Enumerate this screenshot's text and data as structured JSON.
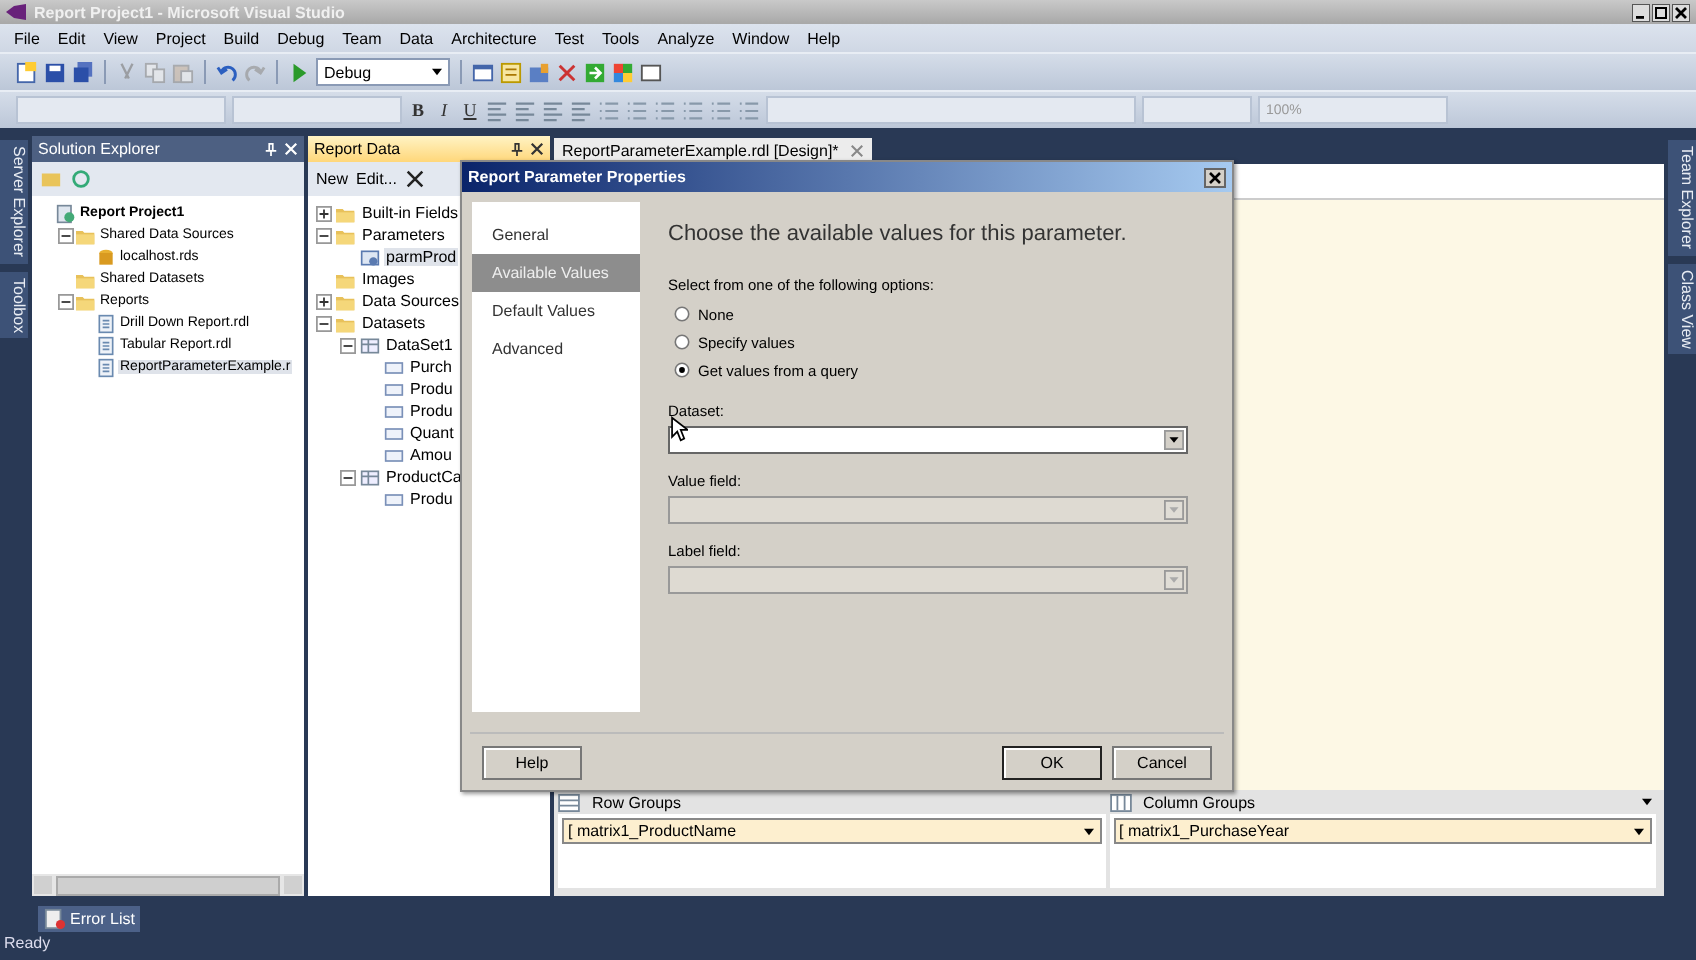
{
  "window": {
    "title": "Report Project1 - Microsoft Visual Studio"
  },
  "menu": [
    "File",
    "Edit",
    "View",
    "Project",
    "Build",
    "Debug",
    "Team",
    "Data",
    "Architecture",
    "Test",
    "Tools",
    "Analyze",
    "Window",
    "Help"
  ],
  "toolbar": {
    "configuration": "Debug",
    "format_buttons": [
      "B",
      "I",
      "U"
    ],
    "zoom": "100%"
  },
  "left_strip": [
    "Server Explorer",
    "Toolbox"
  ],
  "solution_explorer": {
    "title": "Solution Explorer",
    "tree": [
      {
        "label": "Report Project1",
        "kind": "project",
        "selected": false,
        "children": [
          {
            "label": "Shared Data Sources",
            "kind": "folder",
            "expanded": true,
            "selected": false,
            "children": [
              {
                "label": "localhost.rds",
                "kind": "datasource",
                "selected": false
              }
            ]
          },
          {
            "label": "Shared Datasets",
            "kind": "folder",
            "selected": false
          },
          {
            "label": "Reports",
            "kind": "folder",
            "expanded": true,
            "selected": false,
            "children": [
              {
                "label": "Drill Down Report.rdl",
                "kind": "report",
                "selected": false
              },
              {
                "label": "Tabular Report.rdl",
                "kind": "report",
                "selected": false
              },
              {
                "label": "ReportParameterExample.r",
                "kind": "report",
                "selected": true
              }
            ]
          }
        ]
      }
    ]
  },
  "report_data": {
    "title": "Report Data",
    "new": "New",
    "edit": "Edit...",
    "tree": [
      {
        "label": "Built-in Fields",
        "kind": "folder",
        "expanded": false,
        "selected": false
      },
      {
        "label": "Parameters",
        "kind": "folder",
        "expanded": true,
        "selected": false,
        "children": [
          {
            "label": "parmProd",
            "kind": "parameter",
            "selected": true
          }
        ]
      },
      {
        "label": "Images",
        "kind": "folder",
        "selected": false
      },
      {
        "label": "Data Sources",
        "kind": "folder",
        "expanded": false,
        "selected": false
      },
      {
        "label": "Datasets",
        "kind": "folder",
        "expanded": true,
        "selected": false,
        "children": [
          {
            "label": "DataSet1",
            "kind": "dataset",
            "expanded": true,
            "selected": false,
            "children": [
              {
                "label": "Purch",
                "kind": "field",
                "selected": false
              },
              {
                "label": "Produ",
                "kind": "field",
                "selected": false
              },
              {
                "label": "Produ",
                "kind": "field",
                "selected": false
              },
              {
                "label": "Quant",
                "kind": "field",
                "selected": false
              },
              {
                "label": "Amou",
                "kind": "field",
                "selected": false
              }
            ]
          },
          {
            "label": "ProductCa",
            "kind": "dataset",
            "expanded": true,
            "selected": false,
            "children": [
              {
                "label": "Produ",
                "kind": "field",
                "selected": false
              }
            ]
          }
        ]
      }
    ]
  },
  "document_tab": {
    "title": "ReportParameterExample.rdl [Design]*"
  },
  "groups": {
    "row": {
      "title": "Row Groups",
      "item": "[ matrix1_ProductName"
    },
    "column": {
      "title": "Column Groups",
      "item": "[ matrix1_PurchaseYear"
    }
  },
  "dialog": {
    "title": "Report Parameter Properties",
    "nav": [
      {
        "label": "General",
        "selected": false
      },
      {
        "label": "Available Values",
        "selected": true
      },
      {
        "label": "Default Values",
        "selected": false
      },
      {
        "label": "Advanced",
        "selected": false
      }
    ],
    "heading": "Choose the available values for this parameter.",
    "prompt": "Select from one of the following options:",
    "options": [
      {
        "label": "None",
        "selected": false
      },
      {
        "label": "Specify values",
        "selected": false
      },
      {
        "label": "Get values from a query",
        "selected": true
      }
    ],
    "fields": [
      {
        "label": "Dataset:",
        "disabled": false
      },
      {
        "label": "Value field:",
        "disabled": true
      },
      {
        "label": "Label field:",
        "disabled": true
      }
    ],
    "buttons": {
      "help": "Help",
      "ok": "OK",
      "cancel": "Cancel"
    }
  },
  "right_strip": [
    "Team Explorer",
    "Class View"
  ],
  "bottom_tab": "Error List",
  "status_bar": "Ready"
}
